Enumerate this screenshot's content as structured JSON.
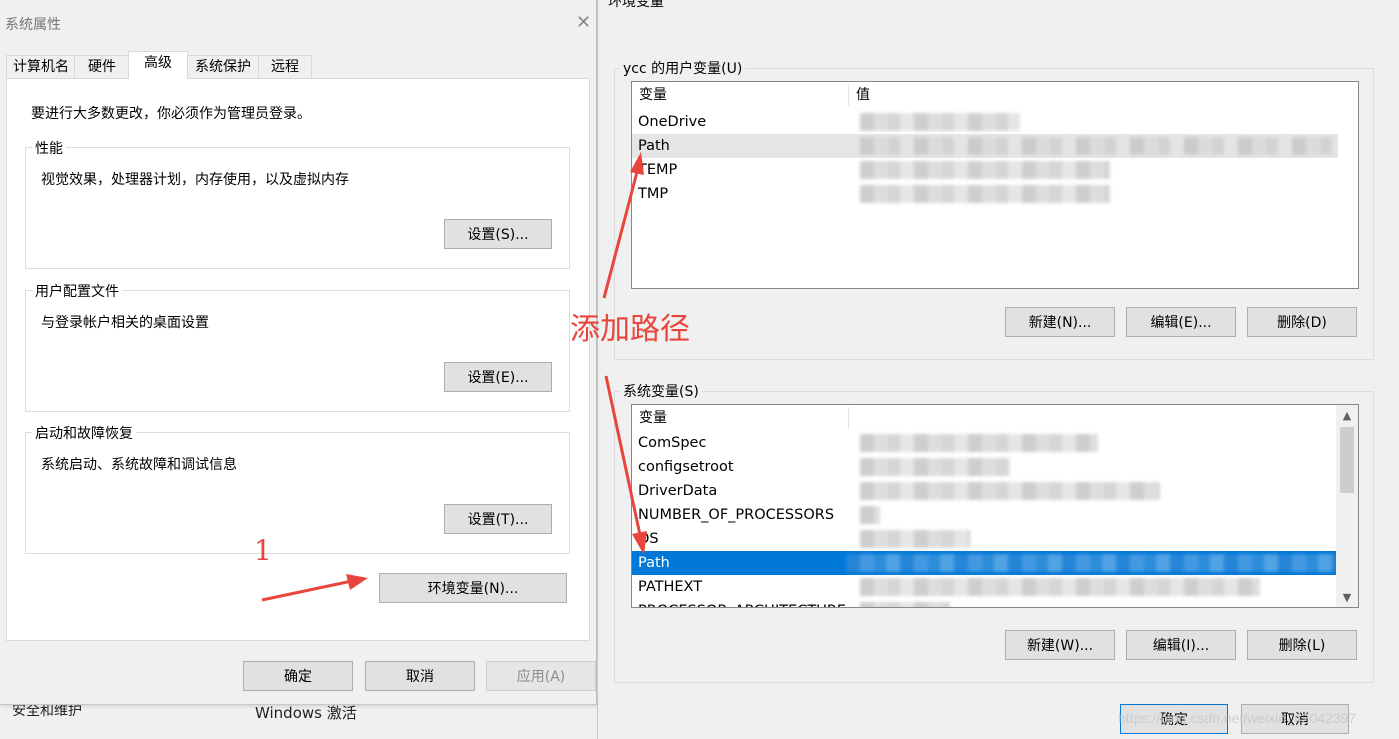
{
  "background_window": {
    "sidebar_item": "安全和维护",
    "activation_title": "Windows 激活"
  },
  "system_properties": {
    "title": "系统属性",
    "close_glyph": "✕",
    "tabs": [
      {
        "label": "计算机名"
      },
      {
        "label": "硬件"
      },
      {
        "label": "高级"
      },
      {
        "label": "系统保护"
      },
      {
        "label": "远程"
      }
    ],
    "active_tab": "高级",
    "admin_note": "要进行大多数更改，你必须作为管理员登录。",
    "performance": {
      "title": "性能",
      "description": "视觉效果，处理器计划，内存使用，以及虚拟内存",
      "button": "设置(S)..."
    },
    "user_profiles": {
      "title": "用户配置文件",
      "description": "与登录帐户相关的桌面设置",
      "button": "设置(E)..."
    },
    "startup_recovery": {
      "title": "启动和故障恢复",
      "description": "系统启动、系统故障和调试信息",
      "button": "设置(T)..."
    },
    "env_button": "环境变量(N)...",
    "footer": {
      "ok": "确定",
      "cancel": "取消",
      "apply": "应用(A)"
    }
  },
  "environment_variables": {
    "title": "环境变量",
    "user_section": {
      "legend": "ycc 的用户变量(U)",
      "columns": {
        "variable": "变量",
        "value": "值"
      },
      "rows": [
        {
          "name": "OneDrive"
        },
        {
          "name": "Path"
        },
        {
          "name": "TEMP"
        },
        {
          "name": "TMP"
        }
      ],
      "hovered_row": "Path",
      "buttons": {
        "new": "新建(N)...",
        "edit": "编辑(E)...",
        "delete": "删除(D)"
      }
    },
    "system_section": {
      "legend": "系统变量(S)",
      "columns": {
        "variable": "变量"
      },
      "rows": [
        {
          "name": "ComSpec"
        },
        {
          "name": "configsetroot"
        },
        {
          "name": "DriverData"
        },
        {
          "name": "NUMBER_OF_PROCESSORS"
        },
        {
          "name": "OS"
        },
        {
          "name": "Path"
        },
        {
          "name": "PATHEXT"
        },
        {
          "name": "PROCESSOR_ARCHITECTURE"
        }
      ],
      "selected_row": "Path",
      "buttons": {
        "new": "新建(W)...",
        "edit": "编辑(I)...",
        "delete": "删除(L)"
      }
    },
    "footer": {
      "ok": "确定",
      "cancel": "取消"
    }
  },
  "annotations": {
    "step_number": "1",
    "callout_text": "添加路径",
    "color": "#e8453c"
  },
  "watermark": "https://blog.csdn.net/weixin_42042397",
  "colors": {
    "selection": "#0078d7",
    "hover": "#e5e5e5",
    "dialog_bg": "#f0f0f0"
  }
}
